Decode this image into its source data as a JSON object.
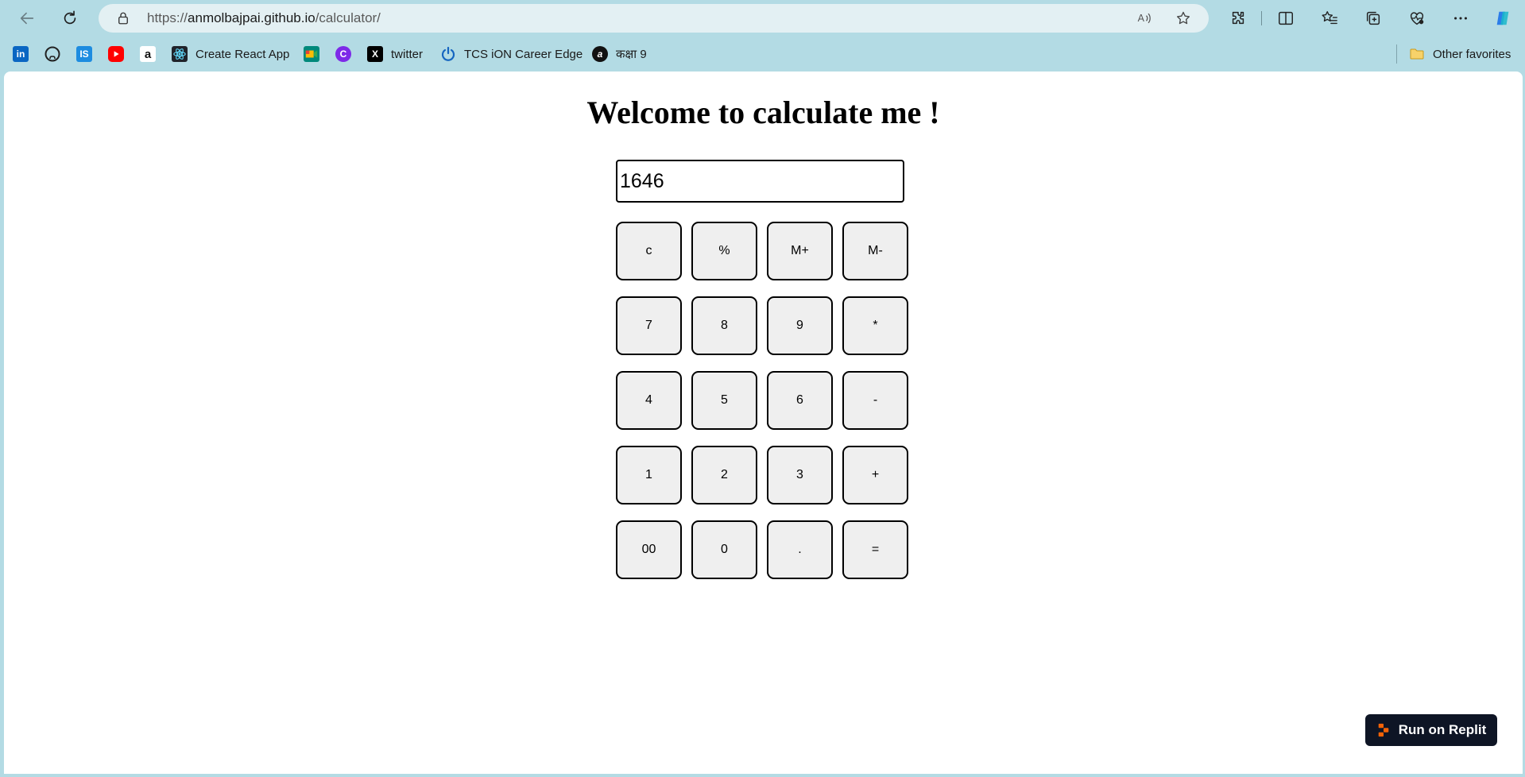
{
  "browser": {
    "url_prefix": "https://",
    "url_host": "anmolbajpai.github.io",
    "url_path": "/calculator/",
    "favorites": [
      {
        "label": "",
        "icon": "linkedin-icon"
      },
      {
        "label": "",
        "icon": "github-icon"
      },
      {
        "label": "",
        "icon": "is-icon"
      },
      {
        "label": "",
        "icon": "youtube-icon"
      },
      {
        "label": "",
        "icon": "amazon-icon"
      },
      {
        "label": "Create React App",
        "icon": "react-icon"
      },
      {
        "label": "",
        "icon": "meet-icon"
      },
      {
        "label": "",
        "icon": "canva-icon"
      },
      {
        "label": "twitter",
        "icon": "x-icon"
      },
      {
        "label": "TCS iON Career Edge",
        "icon": "power-icon"
      },
      {
        "label": "कक्षा 9",
        "icon": "a-icon"
      }
    ],
    "other_favorites": "Other favorites"
  },
  "page": {
    "title": "Welcome to calculate me !",
    "display_value": "1646",
    "keys": [
      [
        "c",
        "%",
        "M+",
        "M-"
      ],
      [
        "7",
        "8",
        "9",
        "*"
      ],
      [
        "4",
        "5",
        "6",
        "-"
      ],
      [
        "1",
        "2",
        "3",
        "+"
      ],
      [
        "00",
        "0",
        ".",
        "="
      ]
    ],
    "replit_label": "Run on Replit"
  },
  "colors": {
    "browser_chrome": "#b3dbe4",
    "address_bar": "#e3f0f3",
    "key_bg": "#efefef",
    "replit_bg": "#0e1525",
    "replit_accent": "#f26207"
  }
}
